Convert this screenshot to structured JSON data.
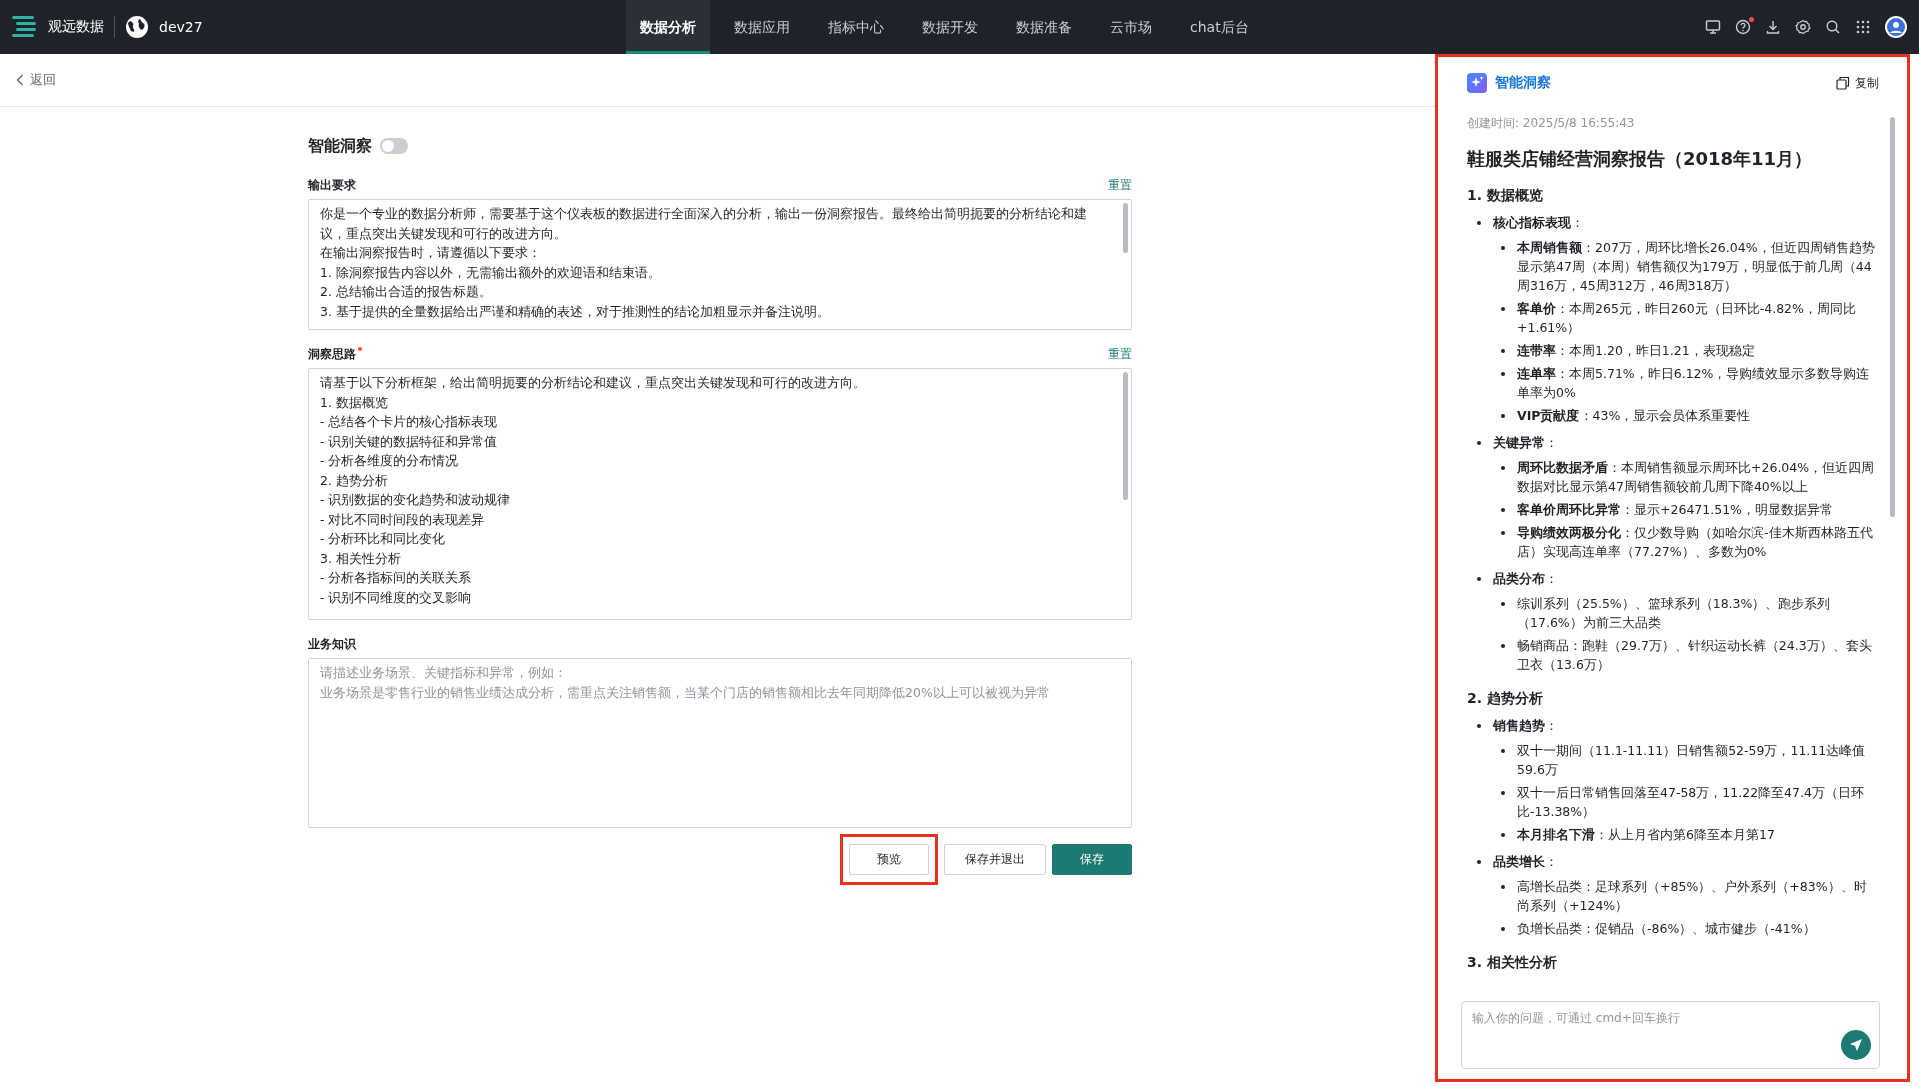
{
  "topbar": {
    "brand": "观远数据",
    "workspace": "dev27",
    "nav": [
      {
        "label": "数据分析",
        "selected": true
      },
      {
        "label": "数据应用",
        "selected": false
      },
      {
        "label": "指标中心",
        "selected": false
      },
      {
        "label": "数据开发",
        "selected": false
      },
      {
        "label": "数据准备",
        "selected": false
      },
      {
        "label": "云市场",
        "selected": false
      },
      {
        "label": "chat后台",
        "selected": false
      }
    ],
    "help_badge": true
  },
  "back": {
    "label": "返回"
  },
  "form": {
    "title": "智能洞察",
    "toggle_on": false,
    "fields": [
      {
        "label": "输出要求",
        "required": false,
        "reset": "重置",
        "kind": "text",
        "lines": [
          "你是一个专业的数据分析师，需要基于这个仪表板的数据进行全面深入的分析，输出一份洞察报告。最终给出简明扼要的分析结论和建议，重点突出关键发现和可行的改进方向。",
          "在输出洞察报告时，请遵循以下要求：",
          "1. 除洞察报告内容以外，无需输出额外的欢迎语和结束语。",
          "2. 总结输出合适的报告标题。",
          "3. 基于提供的全量数据给出严谨和精确的表述，对于推测性的结论加粗显示并备注说明。"
        ]
      },
      {
        "label": "洞察思路",
        "required": true,
        "reset": "重置",
        "kind": "text",
        "lines": [
          "请基于以下分析框架，给出简明扼要的分析结论和建议，重点突出关键发现和可行的改进方向。",
          "1. 数据概览",
          "- 总结各个卡片的核心指标表现",
          "- 识别关键的数据特征和异常值",
          "- 分析各维度的分布情况",
          "2. 趋势分析",
          "- 识别数据的变化趋势和波动规律",
          "- 对比不同时间段的表现差异",
          "- 分析环比和同比变化",
          "3. 相关性分析",
          "- 分析各指标间的关联关系",
          "- 识别不同维度的交叉影响"
        ]
      },
      {
        "label": "业务知识",
        "required": false,
        "kind": "placeholder",
        "lines": [
          "请描述业务场景、关键指标和异常，例如：",
          "业务场景是零售行业的销售业绩达成分析，需重点关注销售额，当某个门店的销售额相比去年同期降低20%以上可以被视为异常"
        ]
      }
    ],
    "buttons": [
      {
        "label": "预览",
        "kind": "default",
        "highlighted": true
      },
      {
        "label": "保存并退出",
        "kind": "default",
        "highlighted": false
      },
      {
        "label": "保存",
        "kind": "primary",
        "highlighted": false
      }
    ]
  },
  "panel": {
    "highlighted": true,
    "title": "智能洞察",
    "copy": "复制",
    "created": "创建时间: 2025/5/8 16:55:43",
    "report_title": "鞋服类店铺经营洞察报告（2018年11月）",
    "sections": [
      {
        "heading": "1. 数据概览",
        "groups": [
          {
            "label": "**核心指标表现**：",
            "items": [
              "**本周销售额**：207万，周环比增长26.04%，但近四周销售趋势显示第47周（本周）销售额仅为179万，明显低于前几周（44周316万，45周312万，46周318万）",
              "**客单价**：本周265元，昨日260元（日环比-4.82%，周同比+1.61%）",
              "**连带率**：本周1.20，昨日1.21，表现稳定",
              "**连单率**：本周5.71%，昨日6.12%，导购绩效显示多数导购连单率为0%",
              "**VIP贡献度**：43%，显示会员体系重要性"
            ]
          },
          {
            "label": "**关键异常**：",
            "items": [
              "**周环比数据矛盾**：本周销售额显示周环比+26.04%，但近四周数据对比显示第47周销售额较前几周下降40%以上",
              "**客单价周环比异常**：显示+26471.51%，明显数据异常",
              "**导购绩效两极分化**：仅少数导购（如哈尔滨-佳木斯西林路五代店）实现高连单率（77.27%）、多数为0%"
            ]
          },
          {
            "label": "**品类分布**：",
            "items": [
              "综训系列（25.5%）、篮球系列（18.3%）、跑步系列（17.6%）为前三大品类",
              "畅销商品：跑鞋（29.7万）、针织运动长裤（24.3万）、套头卫衣（13.6万）"
            ]
          }
        ]
      },
      {
        "heading": "2. 趋势分析",
        "groups": [
          {
            "label": "**销售趋势**：",
            "items": [
              "双十一期间（11.1-11.11）日销售额52-59万，11.11达峰值59.6万",
              "双十一后日常销售回落至47-58万，11.22降至47.4万（日环比-13.38%）",
              "**本月排名下滑**：从上月省内第6降至本月第17"
            ]
          },
          {
            "label": "**品类增长**：",
            "items": [
              "高增长品类：足球系列（+85%）、户外系列（+83%）、时尚系列（+124%）",
              "负增长品类：促销品（-86%）、城市健步（-41%）"
            ]
          }
        ]
      },
      {
        "heading": "3. 相关性分析"
      }
    ],
    "input_placeholder": "输入你的问题，可通过 cmd+回车换行"
  }
}
